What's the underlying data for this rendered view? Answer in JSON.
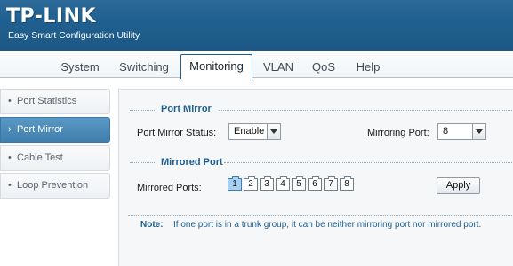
{
  "header": {
    "logo": "TP-LINK",
    "subtitle": "Easy Smart Configuration Utility"
  },
  "tabs": [
    {
      "label": "System",
      "active": false
    },
    {
      "label": "Switching",
      "active": false
    },
    {
      "label": "Monitoring",
      "active": true
    },
    {
      "label": "VLAN",
      "active": false
    },
    {
      "label": "QoS",
      "active": false
    },
    {
      "label": "Help",
      "active": false
    }
  ],
  "sidebar": {
    "items": [
      {
        "bullet": "•",
        "label": "Port Statistics",
        "active": false
      },
      {
        "bullet": "›",
        "label": "Port Mirror",
        "active": true
      },
      {
        "bullet": "•",
        "label": "Cable Test",
        "active": false
      },
      {
        "bullet": "•",
        "label": "Loop Prevention",
        "active": false
      }
    ]
  },
  "port_mirror": {
    "section_title": "Port Mirror",
    "status_label": "Port Mirror Status:",
    "status_value": "Enable",
    "mirroring_port_label": "Mirroring Port:",
    "mirroring_port_value": "8"
  },
  "mirrored_port": {
    "section_title": "Mirrored Port",
    "ports_label": "Mirrored Ports:",
    "ports": [
      "1",
      "2",
      "3",
      "4",
      "5",
      "6",
      "7",
      "8"
    ],
    "selected_ports": [
      "1"
    ],
    "apply_label": "Apply"
  },
  "note": {
    "label": "Note:",
    "text": "If one port is in a trunk group, it can be neither mirroring port nor mirrored port."
  },
  "colors": {
    "header_bg": "#1f5f8f",
    "accent": "#1f5f8f",
    "active_menu": "#4a8ab8"
  }
}
